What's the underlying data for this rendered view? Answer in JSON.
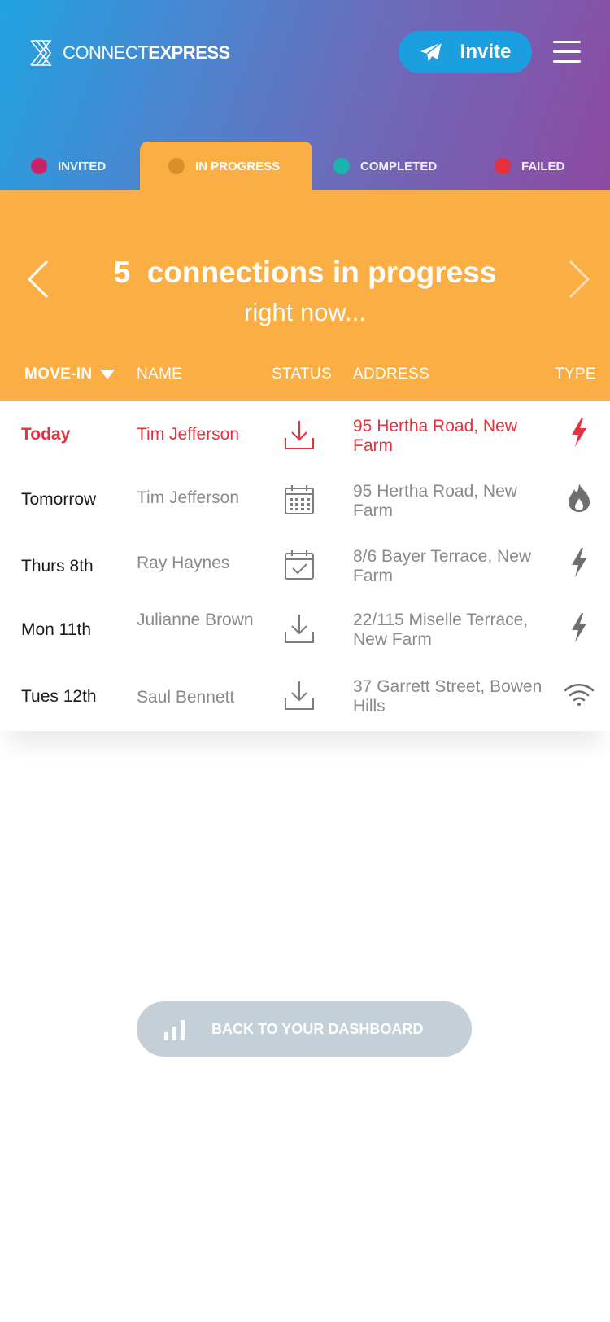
{
  "header": {
    "logo_light": "CONNECT",
    "logo_bold": "EXPRESS",
    "invite_label": "Invite"
  },
  "tabs": [
    {
      "label": "INVITED",
      "color": "#c7236a",
      "active": false
    },
    {
      "label": "IN PROGRESS",
      "color": "#d98f2b",
      "active": true
    },
    {
      "label": "COMPLETED",
      "color": "#1bb5ad",
      "active": false
    },
    {
      "label": "FAILED",
      "color": "#e52f3c",
      "active": false
    }
  ],
  "banner": {
    "count": "5",
    "title_rest": "connections in progress",
    "subtitle": "right now..."
  },
  "columns": {
    "move_in": "MOVE-IN",
    "name": "NAME",
    "status": "STATUS",
    "address": "ADDRESS",
    "type": "TYPE"
  },
  "rows": [
    {
      "date": "Today",
      "name": "Tim Jefferson",
      "status_icon": "download-icon",
      "address": "95 Hertha Road, New Farm",
      "type_icon": "electricity-icon",
      "highlight": true
    },
    {
      "date": "Tomorrow",
      "name": "Tim Jefferson",
      "status_icon": "calendar-icon",
      "address": "95 Hertha Road, New Farm",
      "type_icon": "gas-icon",
      "highlight": false
    },
    {
      "date": "Thurs 8th",
      "name": "Ray Haynes",
      "status_icon": "calendar-check-icon",
      "address": "8/6 Bayer Terrace, New Farm",
      "type_icon": "electricity-icon",
      "highlight": false
    },
    {
      "date": "Mon 11th",
      "name": "Julianne Brown",
      "status_icon": "download-icon",
      "address": "22/115 Miselle Terrace, New Farm",
      "type_icon": "electricity-icon",
      "highlight": false
    },
    {
      "date": "Tues 12th",
      "name": "Saul Bennett",
      "status_icon": "download-icon",
      "address": "37 Garrett Street, Bowen Hills",
      "type_icon": "wifi-icon",
      "highlight": false
    }
  ],
  "dashboard_button": {
    "label": "BACK TO YOUR DASHBOARD"
  },
  "colors": {
    "orange": "#fbae44",
    "highlight_red": "#e8303f",
    "gray_text": "#8a8a8a",
    "button_gray": "#c4cfd7"
  }
}
